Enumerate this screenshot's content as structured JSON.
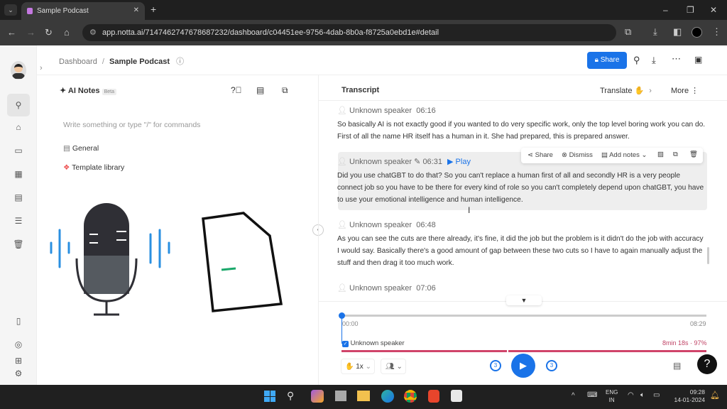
{
  "browser": {
    "tab_title": "Sample Podcast",
    "url": "app.notta.ai/7147462747678687232/dashboard/c04451ee-9756-4dab-8b0a-f8725a0ebd1e#detail"
  },
  "header": {
    "breadcrumb_root": "Dashboard",
    "breadcrumb_sep": "/",
    "title": "Sample Podcast",
    "share_label": "Share"
  },
  "notes": {
    "title": "AI Notes",
    "badge": "Beta",
    "placeholder": "Write something or type \"/\" for commands",
    "items": [
      {
        "label": "General",
        "icon": "document-icon"
      },
      {
        "label": "Template library",
        "icon": "template-icon"
      }
    ]
  },
  "transcript": {
    "title": "Transcript",
    "translate_label": "Translate",
    "more_label": "More",
    "segments": [
      {
        "speaker": "Unknown speaker",
        "time": "06:16",
        "text": "So basically AI is not exactly good if you wanted to do very specific work, only the top level boring work you can do. First of all the name HR itself has a human in it. She had prepared, this is prepared answer."
      },
      {
        "speaker": "Unknown speaker",
        "time": "06:31",
        "text": "Did you use chatGBT to do that? So you can't replace a human first of all and secondly HR is a very people connect job so you have to be there for every kind of role so you can't completely depend upon chatGBT, you have to use your emotional intelligence and human intelligence."
      },
      {
        "speaker": "Unknown speaker",
        "time": "06:48",
        "text": "As you can see the cuts are there already, it's fine, it did the job but the problem is it didn't do the job with accuracy I would say. Basically there's a good amount of gap between these two cuts so I have to again manually adjust the stuff and then drag it too much work."
      },
      {
        "speaker": "Unknown speaker",
        "time": "07:06",
        "text": ""
      }
    ],
    "play_label": "Play",
    "popup": {
      "share": "Share",
      "dismiss": "Dismiss",
      "add_notes": "Add notes"
    }
  },
  "player": {
    "current": "00:00",
    "total": "08:29",
    "progress": 0,
    "speaker": "Unknown speaker",
    "speaker_checked": true,
    "speaker_stats": "8min 18s · 97%",
    "speed": "1x",
    "skip_seconds": "3",
    "accent": "#1a73e8",
    "speaker_bar_color": "#d0446a"
  },
  "taskbar": {
    "lang_top": "ENG",
    "lang_bottom": "IN",
    "time": "09:28",
    "date": "14-01-2024"
  }
}
